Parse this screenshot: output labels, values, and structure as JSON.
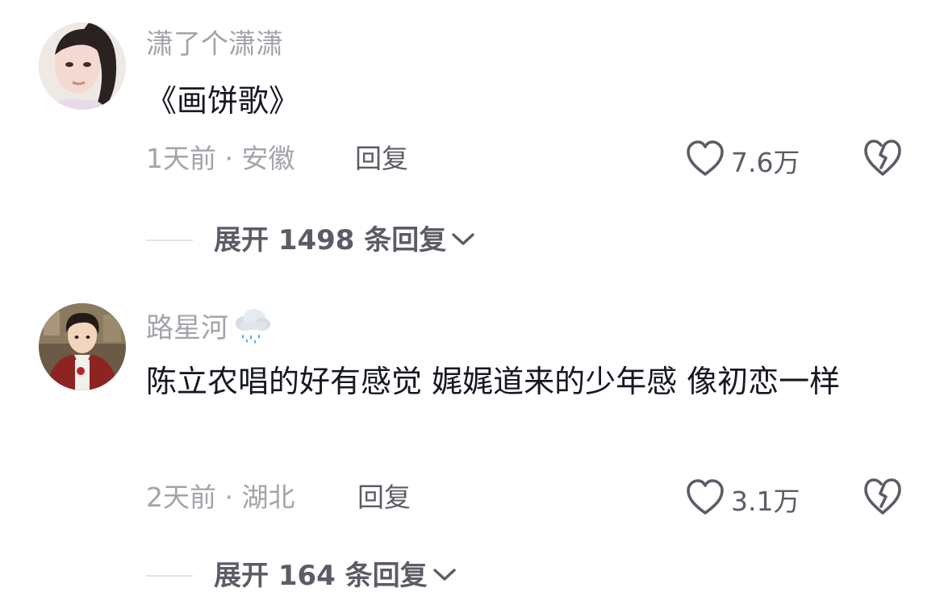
{
  "comments": [
    {
      "username": "潇了个潇潇",
      "content": "《画饼歌》",
      "meta": "1天前 · 安徽",
      "reply_label": "回复",
      "likes": "7.6万",
      "expand_label": "展开 1498 条回复"
    },
    {
      "username": "路星河",
      "username_emoji": "rain-cloud-icon",
      "content": "陈立农唱的好有感觉 娓娓道来的少年感 像初恋一样",
      "meta": "2天前 · 湖北",
      "reply_label": "回复",
      "likes": "3.1万",
      "expand_label": "展开 164 条回复"
    }
  ]
}
